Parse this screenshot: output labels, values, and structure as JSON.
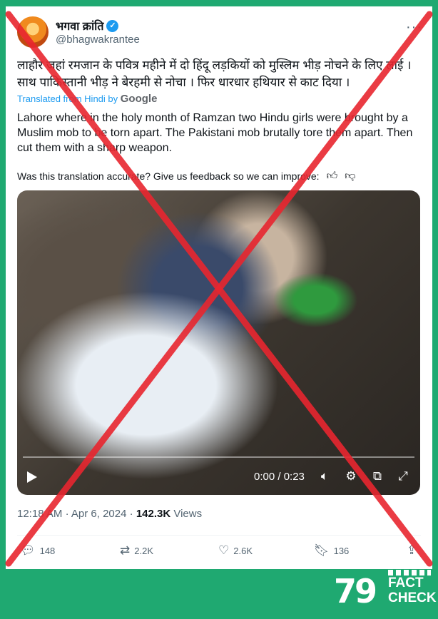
{
  "tweet": {
    "display_name": "भगवा क्रांति",
    "handle": "@bhagwakrantee",
    "text_hindi": "लाहौर जहां रमजान के पवित्र महीने में दो हिंदू लड़कियों को मुस्लिम भीड़ नोचने के लिए लाई ।साथ पाकिस्तानी भीड़ ने बेरहमी से नोचा । फिर धारधार हथियार से काट दिया ।",
    "translated_label": "Translated from Hindi by",
    "translator": "Google",
    "text_english": "Lahore where in the holy month of Ramzan two Hindu girls were brought by a Muslim mob to be torn apart. The Pakistani mob brutally tore them apart. Then cut them with a sharp weapon.",
    "feedback_prompt": "Was this translation accurate? Give us feedback so we can improve:",
    "more_icon": "more-icon"
  },
  "video": {
    "time": "0:00 / 0:23",
    "progress": 0.0
  },
  "meta": {
    "time": "12:18 AM",
    "sep": "·",
    "date": "Apr 6, 2024",
    "views_count": "142.3K",
    "views_label": "Views"
  },
  "actions": {
    "replies": "148",
    "reposts": "2.2K",
    "likes": "2.6K",
    "bookmarks": "136"
  },
  "overlay": {
    "color": "#e8262f"
  },
  "logo": {
    "digits": "79",
    "fact": "FACT",
    "check": "CHECK"
  }
}
